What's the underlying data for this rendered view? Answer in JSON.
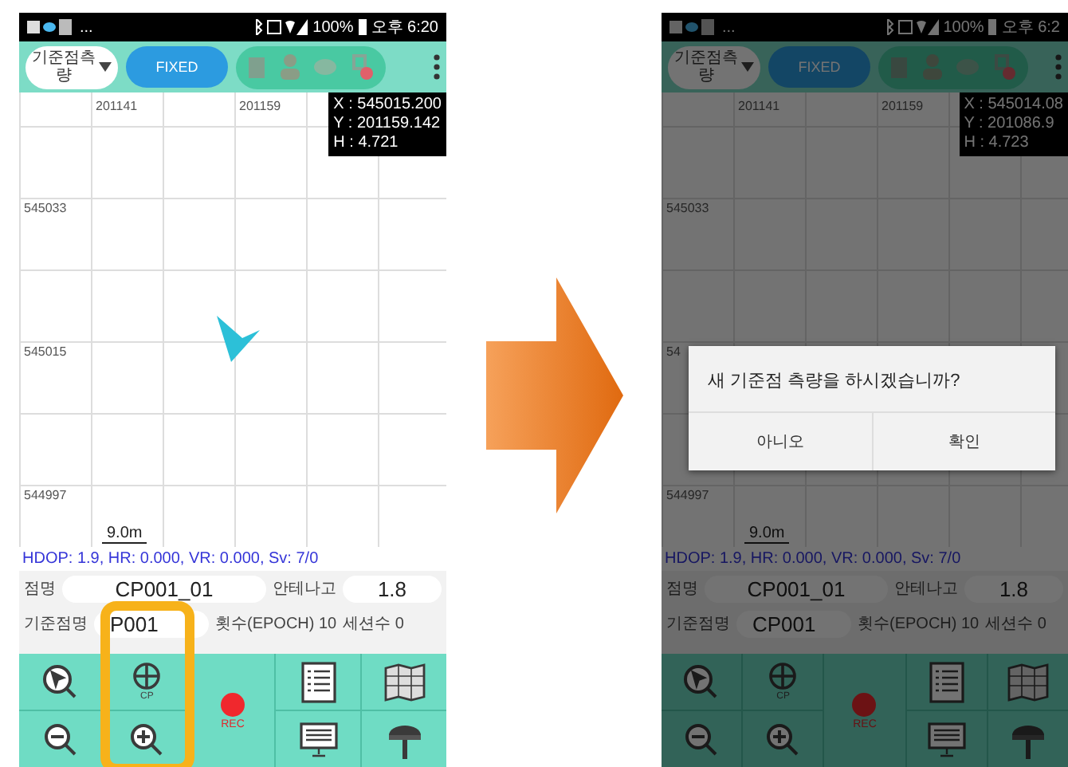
{
  "panels": [
    {
      "dimmed": false,
      "status_bar": {
        "notice": "...",
        "battery": "100%",
        "time": "오후 6:20"
      },
      "toolbar": {
        "mode": "기준점측량",
        "fix": "FIXED"
      },
      "map": {
        "x_labels": [
          "201141",
          "201159"
        ],
        "y_labels": [
          "545033",
          "545015",
          "544997"
        ],
        "coords": [
          "X : 545015.200",
          "Y : 201159.142",
          "H : 4.721"
        ],
        "scale": "9.0m",
        "marker": true
      },
      "quality": "HDOP: 1.9, HR: 0.000, VR: 0.000, Sv: 7/0",
      "point_name": {
        "label": "점명",
        "value": "CP001_01"
      },
      "antenna_height": {
        "label": "안테나고",
        "value": "1.8"
      },
      "base_name": {
        "label": "기준점명",
        "value": "P001"
      },
      "epochs": "횟수(EPOCH) 10",
      "sessions": "세션수 0",
      "tools": [
        {
          "kind": "compass",
          "highlighted": false
        },
        {
          "kind": "crosshair",
          "label": "CP",
          "highlighted": true
        },
        {
          "kind": "record",
          "label": "REC",
          "highlighted": false
        },
        {
          "kind": "checklist",
          "highlighted": false
        },
        {
          "kind": "map",
          "highlighted": false
        },
        {
          "kind": "zoom_out",
          "highlighted": false
        },
        {
          "kind": "zoom_in",
          "highlighted": false
        },
        {
          "kind": "monitor",
          "highlighted": false
        },
        {
          "kind": "antenna",
          "highlighted": false
        }
      ]
    },
    {
      "dimmed": true,
      "status_bar": {
        "notice": "...",
        "battery": "100%",
        "time": "오후 6:2"
      },
      "toolbar": {
        "mode": "기준점측량",
        "fix": "FIXED"
      },
      "map": {
        "x_labels": [
          "201141",
          "201159"
        ],
        "y_labels": [
          "545033",
          "54",
          "544997"
        ],
        "coords": [
          "X : 545014.08",
          "Y : 201086.9",
          "H : 4.723"
        ],
        "scale": "9.0m",
        "marker": false
      },
      "quality": "HDOP: 1.9, HR: 0.000, VR: 0.000, Sv: 7/0",
      "point_name": {
        "label": "점명",
        "value": "CP001_01"
      },
      "antenna_height": {
        "label": "안테나고",
        "value": "1.8"
      },
      "base_name": {
        "label": "기준점명",
        "value": "CP001"
      },
      "epochs": "횟수(EPOCH) 10",
      "sessions": "세션수 0",
      "tools": [
        {
          "kind": "compass",
          "highlighted": false
        },
        {
          "kind": "crosshair",
          "label": "CP",
          "highlighted": false
        },
        {
          "kind": "record",
          "label": "REC",
          "highlighted": false
        },
        {
          "kind": "checklist",
          "highlighted": false
        },
        {
          "kind": "map",
          "highlighted": false
        },
        {
          "kind": "zoom_out",
          "highlighted": false
        },
        {
          "kind": "zoom_in",
          "highlighted": false
        },
        {
          "kind": "monitor",
          "highlighted": false
        },
        {
          "kind": "antenna",
          "highlighted": false
        }
      ],
      "dialog": {
        "message": "새 기준점 측량을 하시겠습니까?",
        "buttons": [
          "아니오",
          "확인"
        ]
      }
    }
  ]
}
